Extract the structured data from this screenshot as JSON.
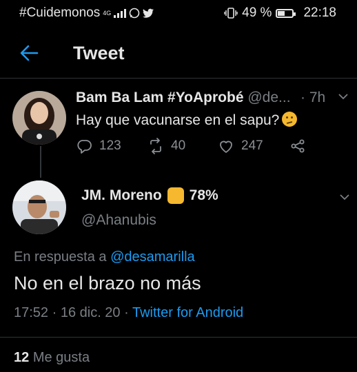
{
  "status_bar": {
    "carrier": "#Cuidemonos",
    "network": "4G",
    "battery_percent": "49 %",
    "battery_level": 0.49,
    "time": "22:18",
    "icons": [
      "signal-bars-icon",
      "whatsapp-icon",
      "twitter-bird-icon",
      "vibrate-icon",
      "battery-icon"
    ]
  },
  "header": {
    "title": "Tweet",
    "back_icon": "arrow-left-icon"
  },
  "parent_tweet": {
    "name": "Bam Ba Lam #YoAprobé",
    "handle": "@de...",
    "time": "· 7h",
    "text": "Hay que vacunarse en el sapu?",
    "emoji": "thinking-face-emoji",
    "replies": "123",
    "retweets": "40",
    "likes": "247"
  },
  "main_tweet": {
    "name": "JM. Moreno",
    "name_suffix": "78%",
    "badge_emoji": "raised-fist-emoji",
    "handle": "@Ahanubis",
    "reply_prefix": "En respuesta a",
    "reply_handle": "@desamarilla",
    "text": "No en el brazo no más",
    "timestamp": "17:52 · 16 dic. 20 ·",
    "source": "Twitter for Android",
    "like_count": "12",
    "like_label": "Me gusta"
  },
  "colors": {
    "background": "#000000",
    "accent": "#1d9bf0",
    "muted": "#7a7f84",
    "text": "#e6e6e6"
  }
}
